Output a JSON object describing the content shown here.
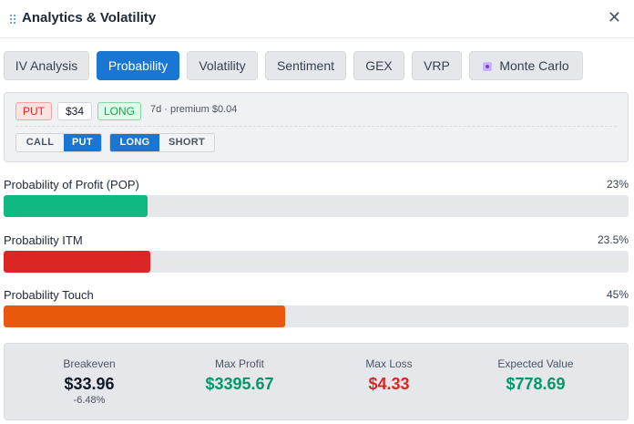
{
  "header": {
    "title": "Analytics & Volatility",
    "close_icon": "close-icon"
  },
  "tabs": [
    {
      "label": "IV Analysis",
      "active": false
    },
    {
      "label": "Probability",
      "active": true
    },
    {
      "label": "Volatility",
      "active": false
    },
    {
      "label": "Sentiment",
      "active": false
    },
    {
      "label": "GEX",
      "active": false
    },
    {
      "label": "VRP",
      "active": false
    },
    {
      "label": "Monte Carlo",
      "active": false,
      "icon": "dice-icon"
    }
  ],
  "config": {
    "type_chip": "PUT",
    "strike_chip": "$34",
    "side_chip": "LONG",
    "meta": "7d · premium $0.04",
    "option_type": {
      "options": [
        "CALL",
        "PUT"
      ],
      "selected": "PUT"
    },
    "position": {
      "options": [
        "LONG",
        "SHORT"
      ],
      "selected": "LONG"
    }
  },
  "probabilities": [
    {
      "label": "Probability of Profit (POP)",
      "value": "23%",
      "fraction": 0.23,
      "color": "#10b981"
    },
    {
      "label": "Probability ITM",
      "value": "23.5%",
      "fraction": 0.235,
      "color": "#dc2626"
    },
    {
      "label": "Probability Touch",
      "value": "45%",
      "fraction": 0.45,
      "color": "#ea580c"
    }
  ],
  "stats": {
    "breakeven": {
      "label": "Breakeven",
      "value": "$33.96",
      "sub": "-6.48%",
      "color": "#111827"
    },
    "max_profit": {
      "label": "Max Profit",
      "value": "$3395.67",
      "color": "#059669"
    },
    "max_loss": {
      "label": "Max Loss",
      "value": "$4.33",
      "color": "#dc2626"
    },
    "expected_value": {
      "label": "Expected Value",
      "value": "$778.69",
      "color": "#059669"
    }
  }
}
